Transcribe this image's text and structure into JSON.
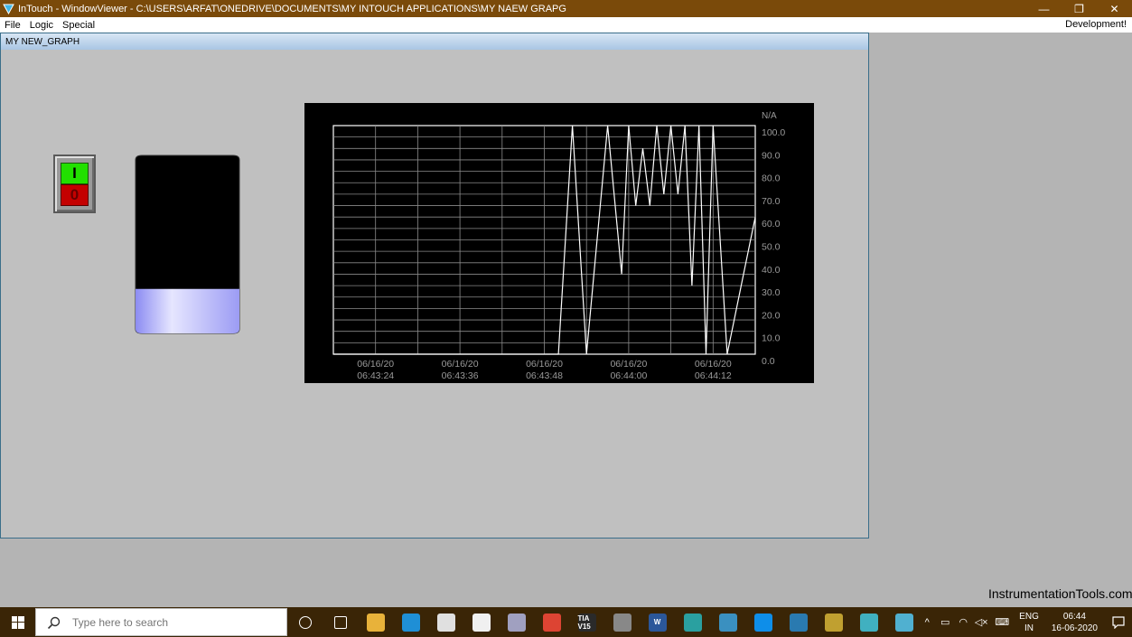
{
  "window": {
    "title": "InTouch - WindowViewer - C:\\USERS\\ARFAT\\ONEDRIVE\\DOCUMENTS\\MY INTOUCH APPLICATIONS\\MY NAEW GRAPG",
    "minimize": "—",
    "restore": "❐",
    "close": "✕"
  },
  "menu": {
    "items": [
      "File",
      "Logic",
      "Special"
    ],
    "development": "Development!"
  },
  "graphic_window": {
    "title": "MY NEW_GRAPH",
    "switch": {
      "on_label": "I",
      "off_label": "0"
    },
    "tank": {
      "level": 0.25,
      "fill_color": "#b0b0ff"
    }
  },
  "chart_data": {
    "type": "line",
    "title": "",
    "unit_label": "N/A",
    "ylim": [
      0,
      100
    ],
    "yticks": [
      "100.0",
      "90.0",
      "80.0",
      "70.0",
      "60.0",
      "50.0",
      "40.0",
      "30.0",
      "20.0",
      "10.0",
      "0.0"
    ],
    "xtick_labels": [
      [
        "06/16/20",
        "06:43:24"
      ],
      [
        "06/16/20",
        "06:43:36"
      ],
      [
        "06/16/20",
        "06:43:48"
      ],
      [
        "06/16/20",
        "06:44:00"
      ],
      [
        "06/16/20",
        "06:44:12"
      ]
    ],
    "xlim": [
      "06:43:20",
      "06:44:20"
    ],
    "grid": true,
    "series": [
      {
        "color": "#ffffff",
        "x": [
          "06:43:20",
          "06:43:52",
          "06:43:54",
          "06:43:56",
          "06:43:59",
          "06:44:01",
          "06:44:02",
          "06:44:03",
          "06:44:04",
          "06:44:05",
          "06:44:06",
          "06:44:07",
          "06:44:08",
          "06:44:09",
          "06:44:10",
          "06:44:11",
          "06:44:12",
          "06:44:13",
          "06:44:14",
          "06:44:16",
          "06:44:18",
          "06:44:20"
        ],
        "y": [
          0,
          0,
          100,
          0,
          100,
          35,
          100,
          65,
          90,
          65,
          100,
          70,
          100,
          70,
          100,
          30,
          100,
          0,
          100,
          0,
          30,
          60
        ]
      }
    ]
  },
  "taskbar": {
    "search_placeholder": "Type here to search",
    "lang_line1": "ENG",
    "lang_line2": "IN",
    "time": "06:44",
    "date": "16-06-2020",
    "icons": [
      {
        "name": "cortana-icon",
        "label": "",
        "color": ""
      },
      {
        "name": "task-view-icon",
        "label": "",
        "color": ""
      },
      {
        "name": "file-explorer-icon",
        "label": "",
        "color": "#e8b23a"
      },
      {
        "name": "edge-icon",
        "label": "",
        "color": "#1f8fd6"
      },
      {
        "name": "store-icon",
        "label": "",
        "color": "#e0e0e0"
      },
      {
        "name": "mail-icon",
        "label": "",
        "color": "#f0f0f0"
      },
      {
        "name": "app-icon",
        "label": "",
        "color": "#a0a0c0"
      },
      {
        "name": "chrome-icon",
        "label": "",
        "color": "#dd4433"
      },
      {
        "name": "tia-portal-icon",
        "label": "TIA V15",
        "color": "#2a2a2a"
      },
      {
        "name": "tool-icon",
        "label": "",
        "color": "#888888"
      },
      {
        "name": "word-icon",
        "label": "W",
        "color": "#2b579a"
      },
      {
        "name": "app2-icon",
        "label": "",
        "color": "#2aa0a0"
      },
      {
        "name": "app3-icon",
        "label": "",
        "color": "#3a90c0"
      },
      {
        "name": "teamviewer-icon",
        "label": "",
        "color": "#0e8ee9"
      },
      {
        "name": "app4-icon",
        "label": "",
        "color": "#2a7ab0"
      },
      {
        "name": "app5-icon",
        "label": "",
        "color": "#c0a030"
      },
      {
        "name": "intouch-icon",
        "label": "",
        "color": "#40b0c0"
      },
      {
        "name": "windowviewer-icon",
        "label": "",
        "color": "#50b0d0"
      }
    ]
  },
  "watermark": "InstrumentationTools.com"
}
